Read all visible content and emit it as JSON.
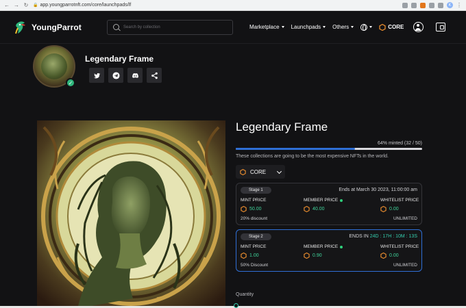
{
  "browser": {
    "url": "app.youngparrotnft.com/core/launchpads/lf",
    "profile_initial": "K"
  },
  "nav": {
    "logo_text": "YoungParrot",
    "search_placeholder": "Search by collection",
    "items": [
      {
        "label": "Marketplace"
      },
      {
        "label": "Launchpads"
      },
      {
        "label": "Others"
      }
    ],
    "chain_label": "CORE"
  },
  "profile": {
    "name": "Legendary Frame"
  },
  "detail": {
    "title": "Legendary Frame",
    "minted_text": "64% minted (32 / 50)",
    "minted_fraction": 0.64,
    "description": "These collections are going to be the most expensive NFTs in the world.",
    "chain_select": "CORE",
    "stages": [
      {
        "name": "Stage 1",
        "right_prefix": "Ends at March 30 2023, 11:00:00 am",
        "countdown": "",
        "mint_label": "MINT PRICE",
        "mint_price": "50.00",
        "member_label": "MEMBER PRICE",
        "member_price": "40.00",
        "whitelist_label": "WHITELIST PRICE",
        "whitelist_price": "0.00",
        "discount": "20% discount",
        "limit": "UNLIMITED"
      },
      {
        "name": "Stage 2",
        "right_prefix": "ENDS IN",
        "countdown": "24D : 17H : 10M : 13S",
        "mint_label": "MINT PRICE",
        "mint_price": "1.00",
        "member_label": "MEMBER PRICE",
        "member_price": "0.90",
        "whitelist_label": "WHITELIST PRICE",
        "whitelist_price": "0.00",
        "discount": "50% Discount",
        "limit": "UNLIMITED"
      }
    ],
    "quantity_label": "Quantity"
  },
  "colors": {
    "accent_blue": "#2f6fd6",
    "price_green": "#3fd39a",
    "core_orange": "#e58a2e",
    "teal": "#35d0b0"
  }
}
